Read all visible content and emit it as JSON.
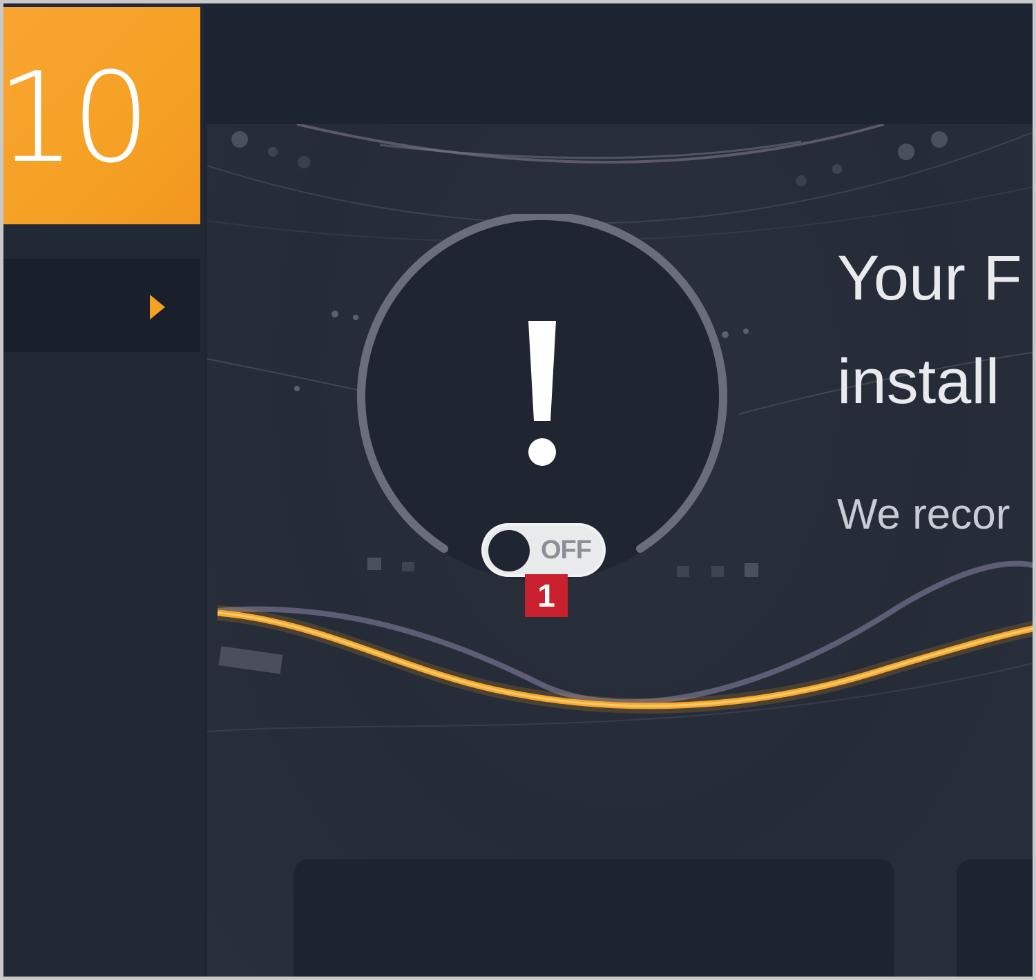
{
  "sidebar": {
    "version_label": "10",
    "expand_icon": "chevron-right-icon",
    "accent_color": "#f5a124"
  },
  "status": {
    "icon": "exclamation-icon",
    "toggle_state": "OFF",
    "marker_label": "1",
    "marker_color": "#c8202c"
  },
  "hero": {
    "headline_line1": "Your F",
    "headline_line2": "install",
    "subline": "We recor"
  },
  "colors": {
    "background": "#1f2531",
    "wave_accent": "#f5a124"
  }
}
